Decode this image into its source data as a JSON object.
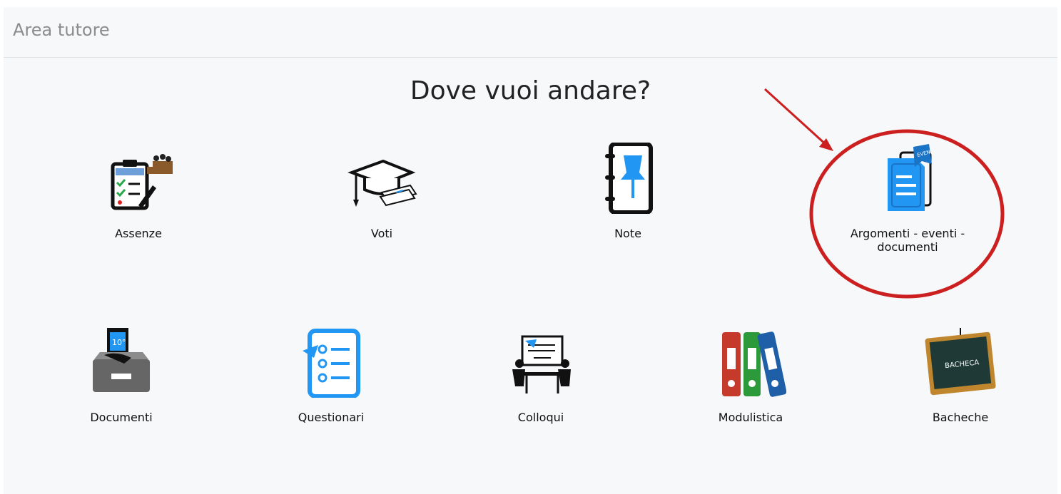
{
  "header": {
    "title": "Area tutore"
  },
  "main": {
    "heading": "Dove vuoi andare?",
    "tiles_row1": [
      {
        "label": "Assenze",
        "icon": "attendance-icon"
      },
      {
        "label": "Voti",
        "icon": "graduation-cap-icon"
      },
      {
        "label": "Note",
        "icon": "notebook-pin-icon"
      },
      {
        "label": "Argomenti - eventi - documenti",
        "icon": "document-tag-icon"
      }
    ],
    "tiles_row2": [
      {
        "label": "Documenti",
        "icon": "archive-box-icon"
      },
      {
        "label": "Questionari",
        "icon": "questionnaire-icon"
      },
      {
        "label": "Colloqui",
        "icon": "meeting-icon"
      },
      {
        "label": "Modulistica",
        "icon": "binders-icon"
      },
      {
        "label": "Bacheche",
        "icon": "chalkboard-icon"
      }
    ],
    "icon_texts": {
      "documenti_badge": "10°",
      "bacheca_board": "BACHECA",
      "events_tag": "EVEN"
    }
  },
  "colors": {
    "accent_blue": "#2196f3",
    "annotation_red": "#cc1f1f"
  }
}
